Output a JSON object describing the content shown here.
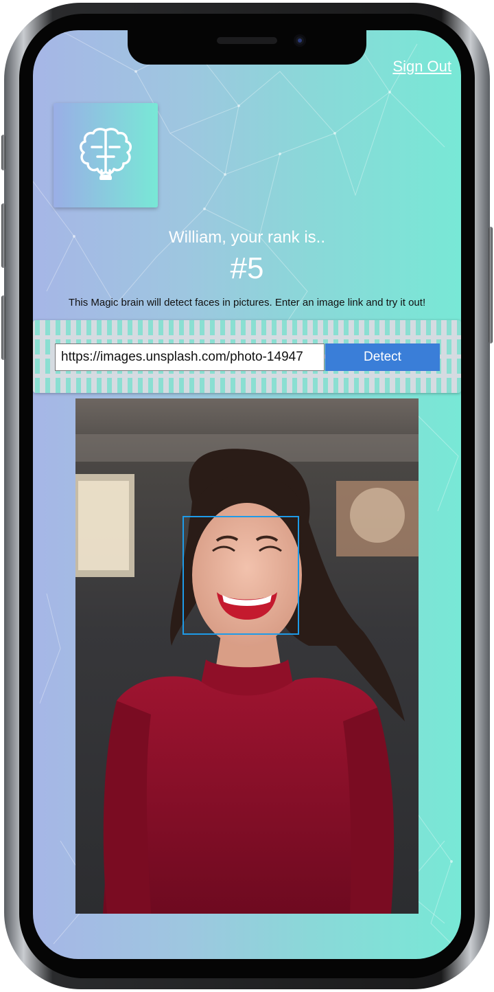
{
  "header": {
    "sign_out_label": "Sign Out"
  },
  "logo": {
    "icon": "brain-icon"
  },
  "rank": {
    "greeting": "William, your rank is..",
    "value": "#5"
  },
  "description": "This Magic brain will detect faces in pictures. Enter an image link and try it out!",
  "form": {
    "url_value": "https://images.unsplash.com/photo-14947",
    "detect_label": "Detect"
  },
  "colors": {
    "gradient_start": "#a6b6e6",
    "gradient_end": "#78e8d6",
    "detect_button": "#3a7ed8",
    "face_box": "#1e9be8"
  }
}
